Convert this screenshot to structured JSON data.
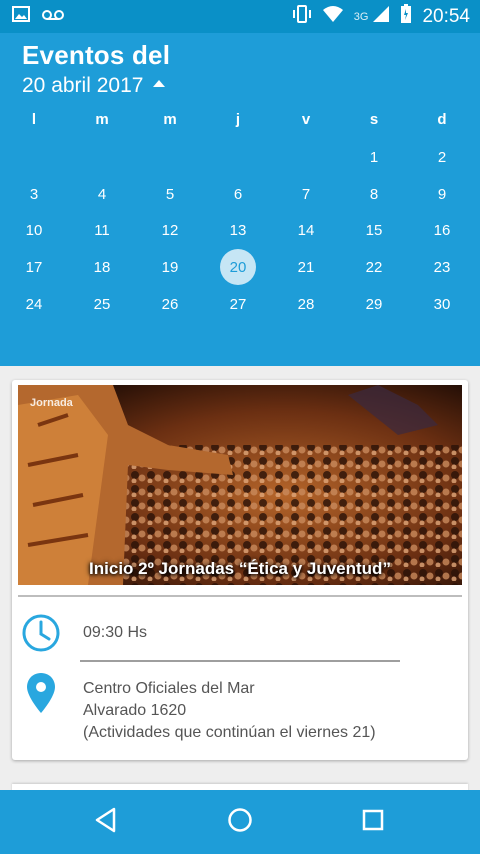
{
  "status_bar": {
    "time": "20:54",
    "network": "3G"
  },
  "header": {
    "title": "Eventos del",
    "date": "20 abril 2017"
  },
  "calendar": {
    "weekdays": [
      "l",
      "m",
      "m",
      "j",
      "v",
      "s",
      "d"
    ],
    "selected": "20",
    "weeks": [
      [
        "",
        "",
        "",
        "",
        "",
        "1",
        "2"
      ],
      [
        "3",
        "4",
        "5",
        "6",
        "7",
        "8",
        "9"
      ],
      [
        "10",
        "11",
        "12",
        "13",
        "14",
        "15",
        "16"
      ],
      [
        "17",
        "18",
        "19",
        "20",
        "21",
        "22",
        "23"
      ],
      [
        "24",
        "25",
        "26",
        "27",
        "28",
        "29",
        "30"
      ]
    ]
  },
  "event": {
    "image_tag": "Jornada",
    "title": "Inicio 2º Jornadas “Ética y Juventud”",
    "time": "09:30 Hs",
    "location_line1": "Centro Oficiales del Mar",
    "location_line2": "Alvarado 1620",
    "location_line3": "(Actividades que continúan el viernes 21)"
  },
  "colors": {
    "primary": "#1e9dd8",
    "status": "#0a90c7",
    "accent_icon": "#29a7df"
  }
}
